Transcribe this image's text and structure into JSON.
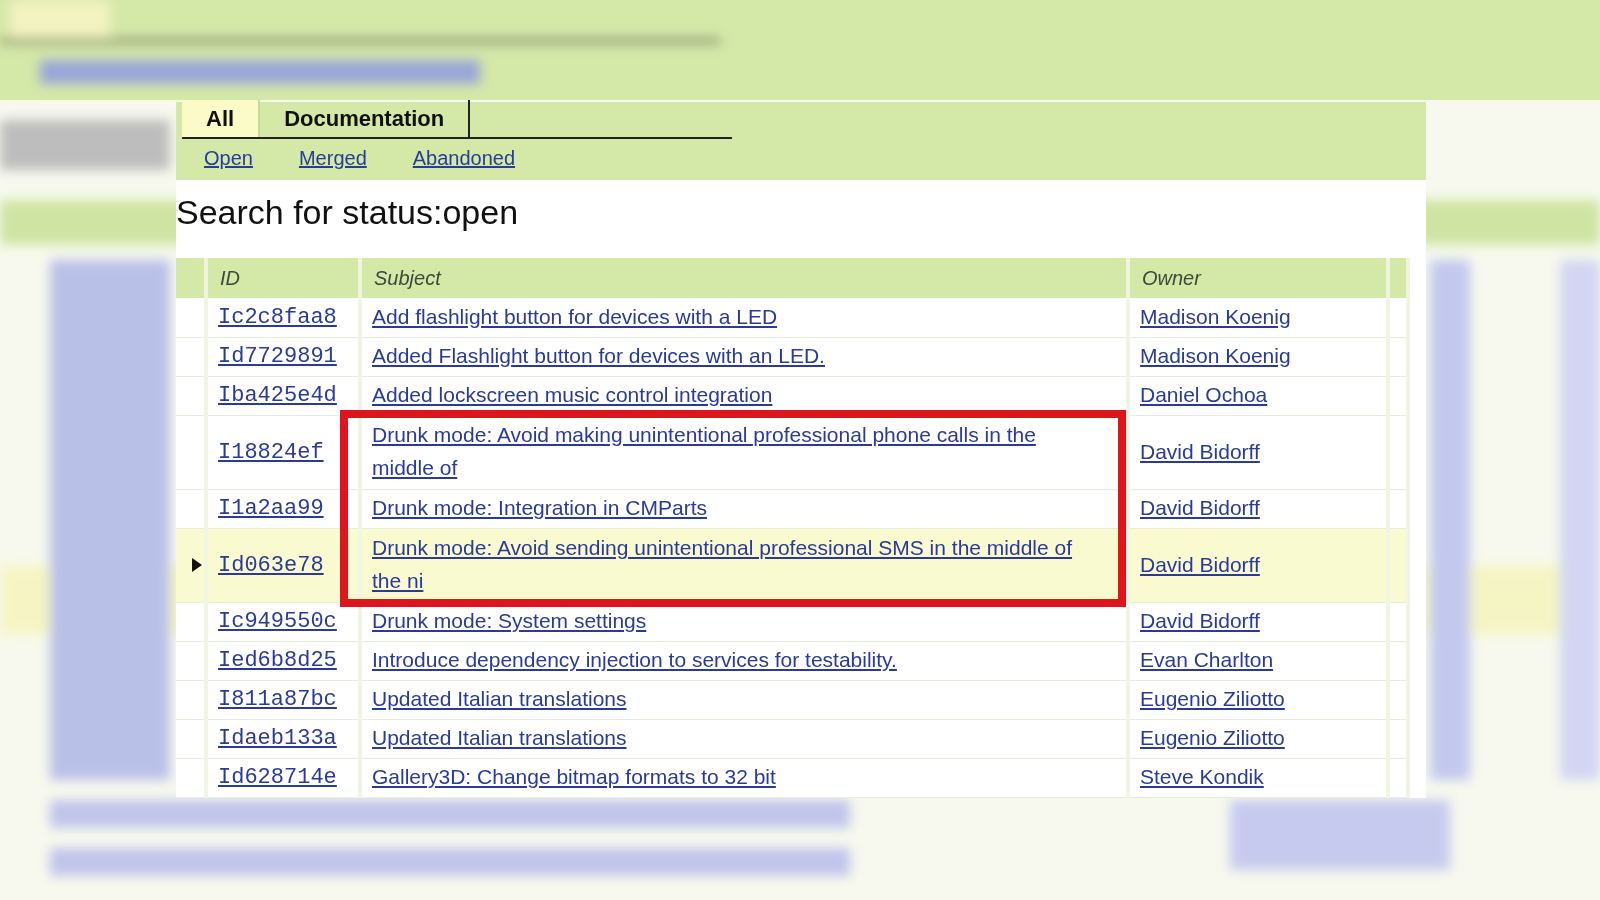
{
  "tabs": [
    {
      "label": "All",
      "selected": true
    },
    {
      "label": "Documentation",
      "selected": false
    }
  ],
  "status_links": [
    {
      "label": "Open"
    },
    {
      "label": "Merged"
    },
    {
      "label": "Abandoned"
    }
  ],
  "title": "Search for status:open",
  "table": {
    "columns": [
      "ID",
      "Subject",
      "Owner"
    ],
    "rows": [
      {
        "id": "Ic2c8faa8",
        "subject": "Add flashlight button for devices with a LED",
        "owner": "Madison Koenig",
        "selected": false
      },
      {
        "id": "Id7729891",
        "subject": "Added Flashlight button for devices with an LED.",
        "owner": "Madison Koenig",
        "selected": false
      },
      {
        "id": "Iba425e4d",
        "subject": "Added lockscreen music control integration",
        "owner": "Daniel Ochoa",
        "selected": false
      },
      {
        "id": "I18824ef",
        "subject": "Drunk mode: Avoid making unintentional professional phone calls in the middle of",
        "owner": "David Bidorff",
        "selected": false
      },
      {
        "id": "I1a2aa99",
        "subject": "Drunk mode: Integration in CMParts",
        "owner": "David Bidorff",
        "selected": false
      },
      {
        "id": "Id063e78",
        "subject": "Drunk mode: Avoid sending unintentional professional SMS in the middle of the ni",
        "owner": "David Bidorff",
        "selected": true
      },
      {
        "id": "Ic949550c",
        "subject": "Drunk mode: System settings",
        "owner": "David Bidorff",
        "selected": false
      },
      {
        "id": "Ied6b8d25",
        "subject": "Introduce dependency injection to services for testability.",
        "owner": "Evan Charlton",
        "selected": false
      },
      {
        "id": "I811a87bc",
        "subject": "Updated Italian translations",
        "owner": "Eugenio Ziliotto",
        "selected": false
      },
      {
        "id": "Idaeb133a",
        "subject": "Updated Italian translations",
        "owner": "Eugenio Ziliotto",
        "selected": false
      },
      {
        "id": "Id628714e",
        "subject": "Gallery3D: Change bitmap formats to 32 bit",
        "owner": "Steve Kondik",
        "selected": false
      }
    ]
  }
}
